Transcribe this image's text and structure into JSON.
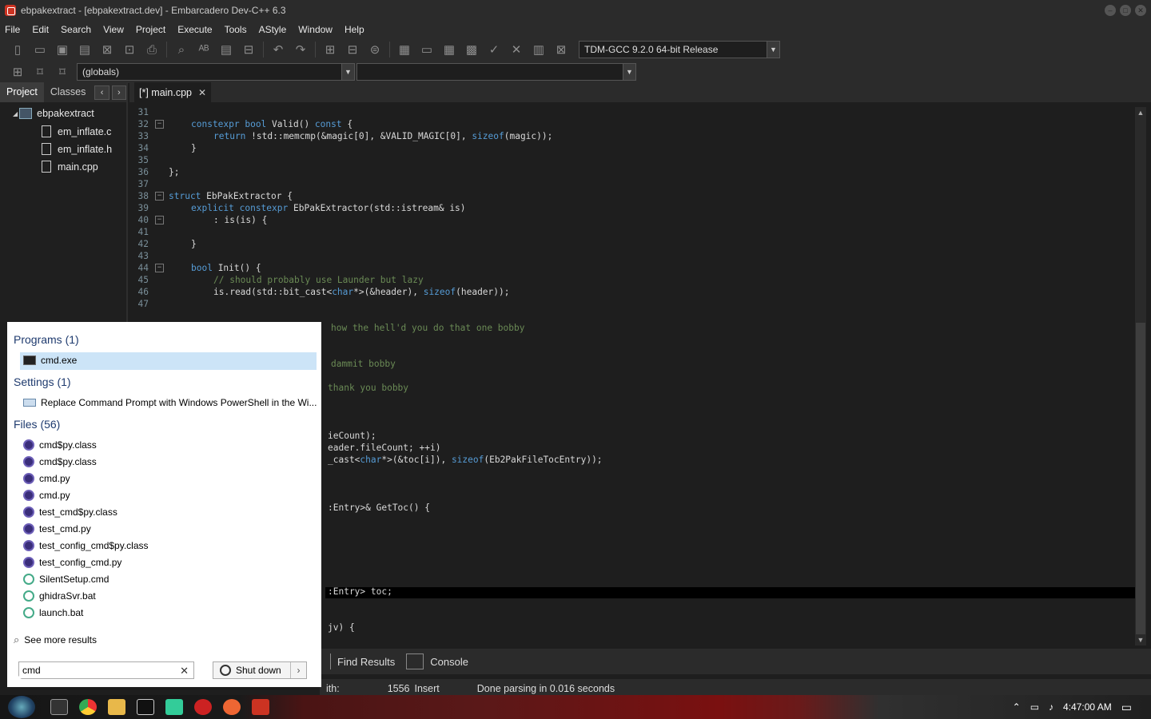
{
  "window": {
    "title": "ebpakextract - [ebpakextract.dev] - Embarcadero Dev-C++ 6.3"
  },
  "menu": [
    "File",
    "Edit",
    "Search",
    "View",
    "Project",
    "Execute",
    "Tools",
    "AStyle",
    "Window",
    "Help"
  ],
  "compiler": "TDM-GCC 9.2.0 64-bit Release",
  "scope": "(globals)",
  "left_panel": {
    "tabs": [
      "Project",
      "Classes"
    ],
    "root": "ebpakextract",
    "files": [
      "em_inflate.c",
      "em_inflate.h",
      "main.cpp"
    ]
  },
  "editor_tab": "[*] main.cpp",
  "code": {
    "line_numbers": [
      "31",
      "32",
      "33",
      "34",
      "35",
      "36",
      "37",
      "38",
      "39",
      "40",
      "41",
      "42",
      "43",
      "44",
      "45",
      "46",
      "47"
    ],
    "l32": [
      "constexpr bool",
      " Valid() ",
      "const",
      " {"
    ],
    "l33": [
      "return",
      " !std::memcmp(&magic[0], &VALID_MAGIC[0], ",
      "sizeof",
      "(magic));"
    ],
    "l34": "}",
    "l36": "};",
    "l38": [
      "struct",
      " EbPakExtractor {"
    ],
    "l39": [
      "explicit constexpr",
      " EbPakExtractor(std::istream& is)"
    ],
    "l40": ": is(is) {",
    "l42": "}",
    "l44": [
      "bool",
      " Init() {"
    ],
    "l45": "// should probably use Launder but lazy",
    "l46": [
      "is.read(std::bit_cast<",
      "char",
      "*>(&header), ",
      "sizeof",
      "(header));"
    ],
    "p1": "how the hell'd you do that one bobby",
    "p2": "dammit bobby",
    "p3": "thank you bobby",
    "p4": "ieCount);",
    "p5": "eader.fileCount; ++i)",
    "p6": [
      "_cast<",
      "char",
      "*>(&toc[i]), ",
      "sizeof",
      "(Eb2PakFileTocEntry));"
    ],
    "p7": ":Entry>& GetToc() {",
    "p8": ":Entry> toc;",
    "p9": "jv) {"
  },
  "bottom_tabs": [
    "Find Results",
    "Console"
  ],
  "status": {
    "length_label": "ith:",
    "position": "1556",
    "mode": "Insert",
    "message": "Done parsing in 0.016 seconds"
  },
  "start_menu": {
    "programs_header": "Programs (1)",
    "program": "cmd.exe",
    "settings_header": "Settings (1)",
    "setting": "Replace Command Prompt with Windows PowerShell in the Wi...",
    "files_header": "Files (56)",
    "files": [
      "cmd$py.class",
      "cmd$py.class",
      "cmd.py",
      "cmd.py",
      "test_cmd$py.class",
      "test_cmd.py",
      "test_config_cmd$py.class",
      "test_config_cmd.py",
      "SilentSetup.cmd",
      "ghidraSvr.bat",
      "launch.bat"
    ],
    "see_more": "See more results",
    "search_value": "cmd",
    "shutdown": "Shut down"
  },
  "taskbar": {
    "time": "4:47:00 AM"
  }
}
